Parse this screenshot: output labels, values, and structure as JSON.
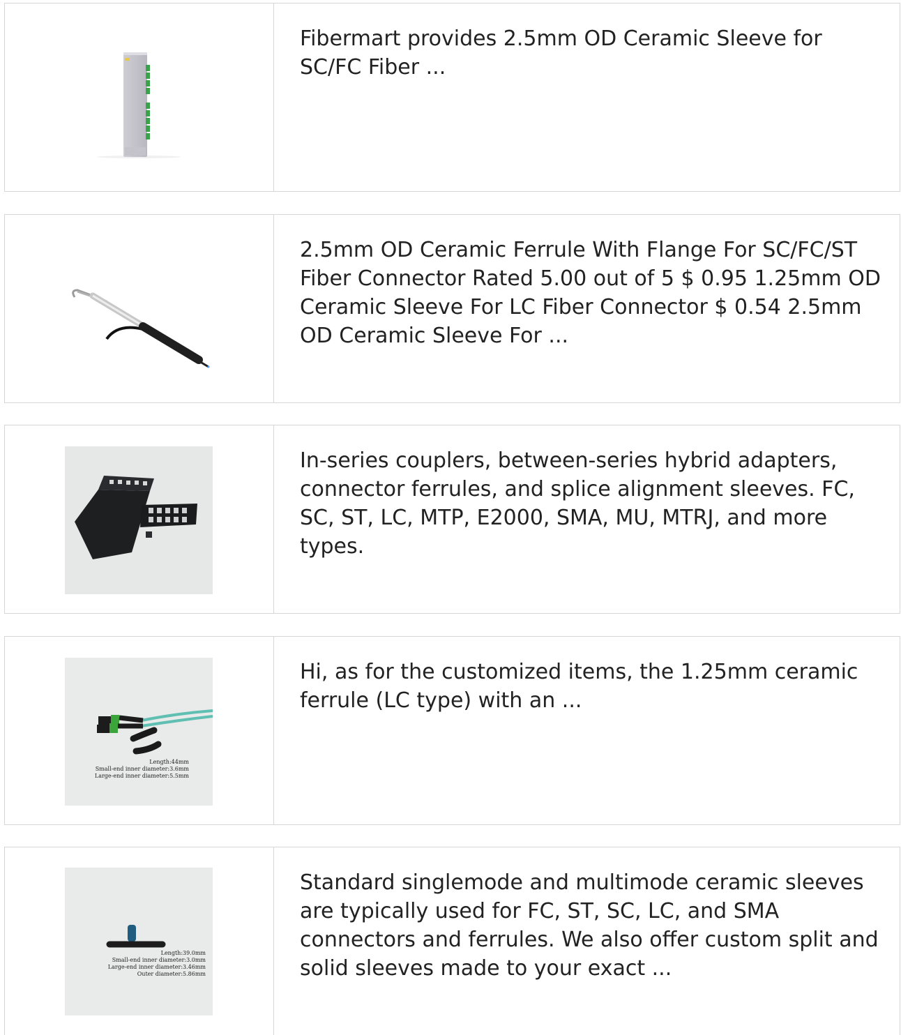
{
  "results": [
    {
      "image_desc_icon": "din-rail-module-image",
      "snippet": "Fibermart provides 2.5mm OD Ceramic Sleeve for SC/FC Fiber ..."
    },
    {
      "image_desc_icon": "tension-clamp-image",
      "snippet": "2.5mm OD Ceramic Ferrule With Flange For SC/FC/ST Fiber Connector Rated 5.00 out of 5 $ 0.95 1.25mm OD Ceramic Sleeve For LC Fiber Connector $ 0.54 2.5mm OD Ceramic Sleeve For ..."
    },
    {
      "image_desc_icon": "fiber-tray-image",
      "snippet": "In-series couplers, between-series hybrid adapters, connector ferrules, and splice alignment sleeves. FC, SC, ST, LC, MTP, E2000, SMA, MU, MTRJ, and more types."
    },
    {
      "image_desc_icon": "mpo-boot-image",
      "snippet": "Hi, as for the customized items, the 1.25mm ceramic ferrule (LC type) with an ...",
      "image_labels": [
        "Length:44mm",
        "Small-end inner diameter:3.6mm",
        "Large-end inner diameter:5.5mm"
      ]
    },
    {
      "image_desc_icon": "sleeve-boot-image",
      "snippet": "Standard singlemode and multimode ceramic sleeves are typically used for FC, ST, SC, LC, and SMA connectors and ferrules. We also offer custom split and solid sleeves made to your exact ...",
      "image_labels": [
        "Length:39.0mm",
        "Small-end inner diameter:3.0mm",
        "Large-end inner diameter:3.46mm",
        "Outer diameter:5.86mm"
      ]
    }
  ],
  "colors": {
    "border": "#d6d6d6",
    "text": "#222222",
    "thumb_bg": "#e9eaea",
    "connector_green": "#3ba53b",
    "cable_aqua": "#5fbfb3",
    "boot_blue": "#1f5c80"
  }
}
